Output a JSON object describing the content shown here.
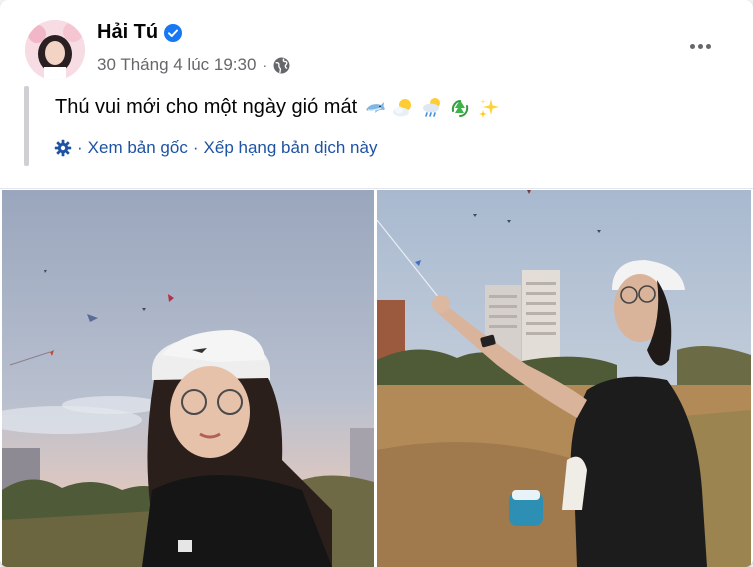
{
  "post": {
    "author": "Hải Tú",
    "timestamp": "30 Tháng 4 lúc 19:30",
    "meta_separator": "·",
    "privacy_icon": "globe-icon",
    "text": "Thú vui mới cho một ngày gió mát",
    "emojis": [
      "dolphin",
      "sun-behind-cloud",
      "sun-behind-rain-cloud",
      "recycle",
      "sparkles"
    ],
    "translation": {
      "icon": "gear-icon",
      "see_original": "Xem bản gốc",
      "separator": "·",
      "rate_translation": "Xếp hạng bản dịch này"
    },
    "photos": [
      {
        "alt_name": "photo-girl-with-cap"
      },
      {
        "alt_name": "photo-girl-flying-kite"
      }
    ]
  },
  "colors": {
    "link_blue": "#1e53a3",
    "verified_blue": "#1877f2",
    "meta_gray": "#65676b",
    "quote_bar": "#ced0d4"
  }
}
